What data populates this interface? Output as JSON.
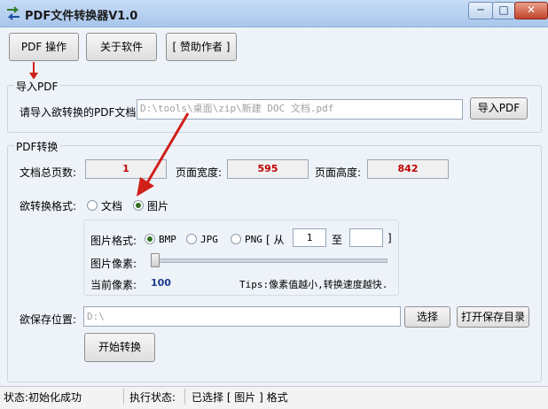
{
  "window": {
    "title": "PDF文件转换器V1.0",
    "min_glyph": "─",
    "max_glyph": "□",
    "close_glyph": "✕"
  },
  "toolbar": {
    "pdf_ops": "PDF 操作",
    "about": "关于软件",
    "sponsor": "[ 赞助作者 ]"
  },
  "import": {
    "group_title": "导入PDF",
    "label": "请导入欲转换的PDF文档:",
    "path_value": "D:\\tools\\桌面\\zip\\新建 DOC 文档.pdf",
    "button": "导入PDF"
  },
  "convert": {
    "group_title": "PDF转换",
    "total_pages_label": "文档总页数:",
    "total_pages": "1",
    "page_width_label": "页面宽度:",
    "page_width": "595",
    "page_height_label": "页面高度:",
    "page_height": "842",
    "format_label": "欲转换格式:",
    "format_options": [
      "文档",
      "图片"
    ],
    "selected_format": "图片",
    "image": {
      "format_label": "图片格式:",
      "formats": [
        "BMP",
        "JPG",
        "PNG"
      ],
      "selected": "BMP",
      "range_open": "[ 从",
      "range_from": "1",
      "range_to_label": "至",
      "range_to": "",
      "range_close": "]",
      "pixel_label": "图片像素:",
      "pixel_slider_level": 0,
      "current_label": "当前像素:",
      "current_value": "100",
      "tips": "Tips:像素值越小,转换速度越快."
    },
    "save_label": "欲保存位置:",
    "save_path": "D:\\",
    "choose_button": "选择",
    "open_dir_button": "打开保存目录",
    "start_button": "开始转换"
  },
  "status": {
    "left": "状态:初始化成功",
    "exec_label": "执行状态:",
    "exec_value": "已选择 [ 图片 ] 格式"
  },
  "colors": {
    "annotation_arrow": "#d0201a",
    "value_text": "#c00000",
    "pixel_value": "#1f3a8a"
  }
}
